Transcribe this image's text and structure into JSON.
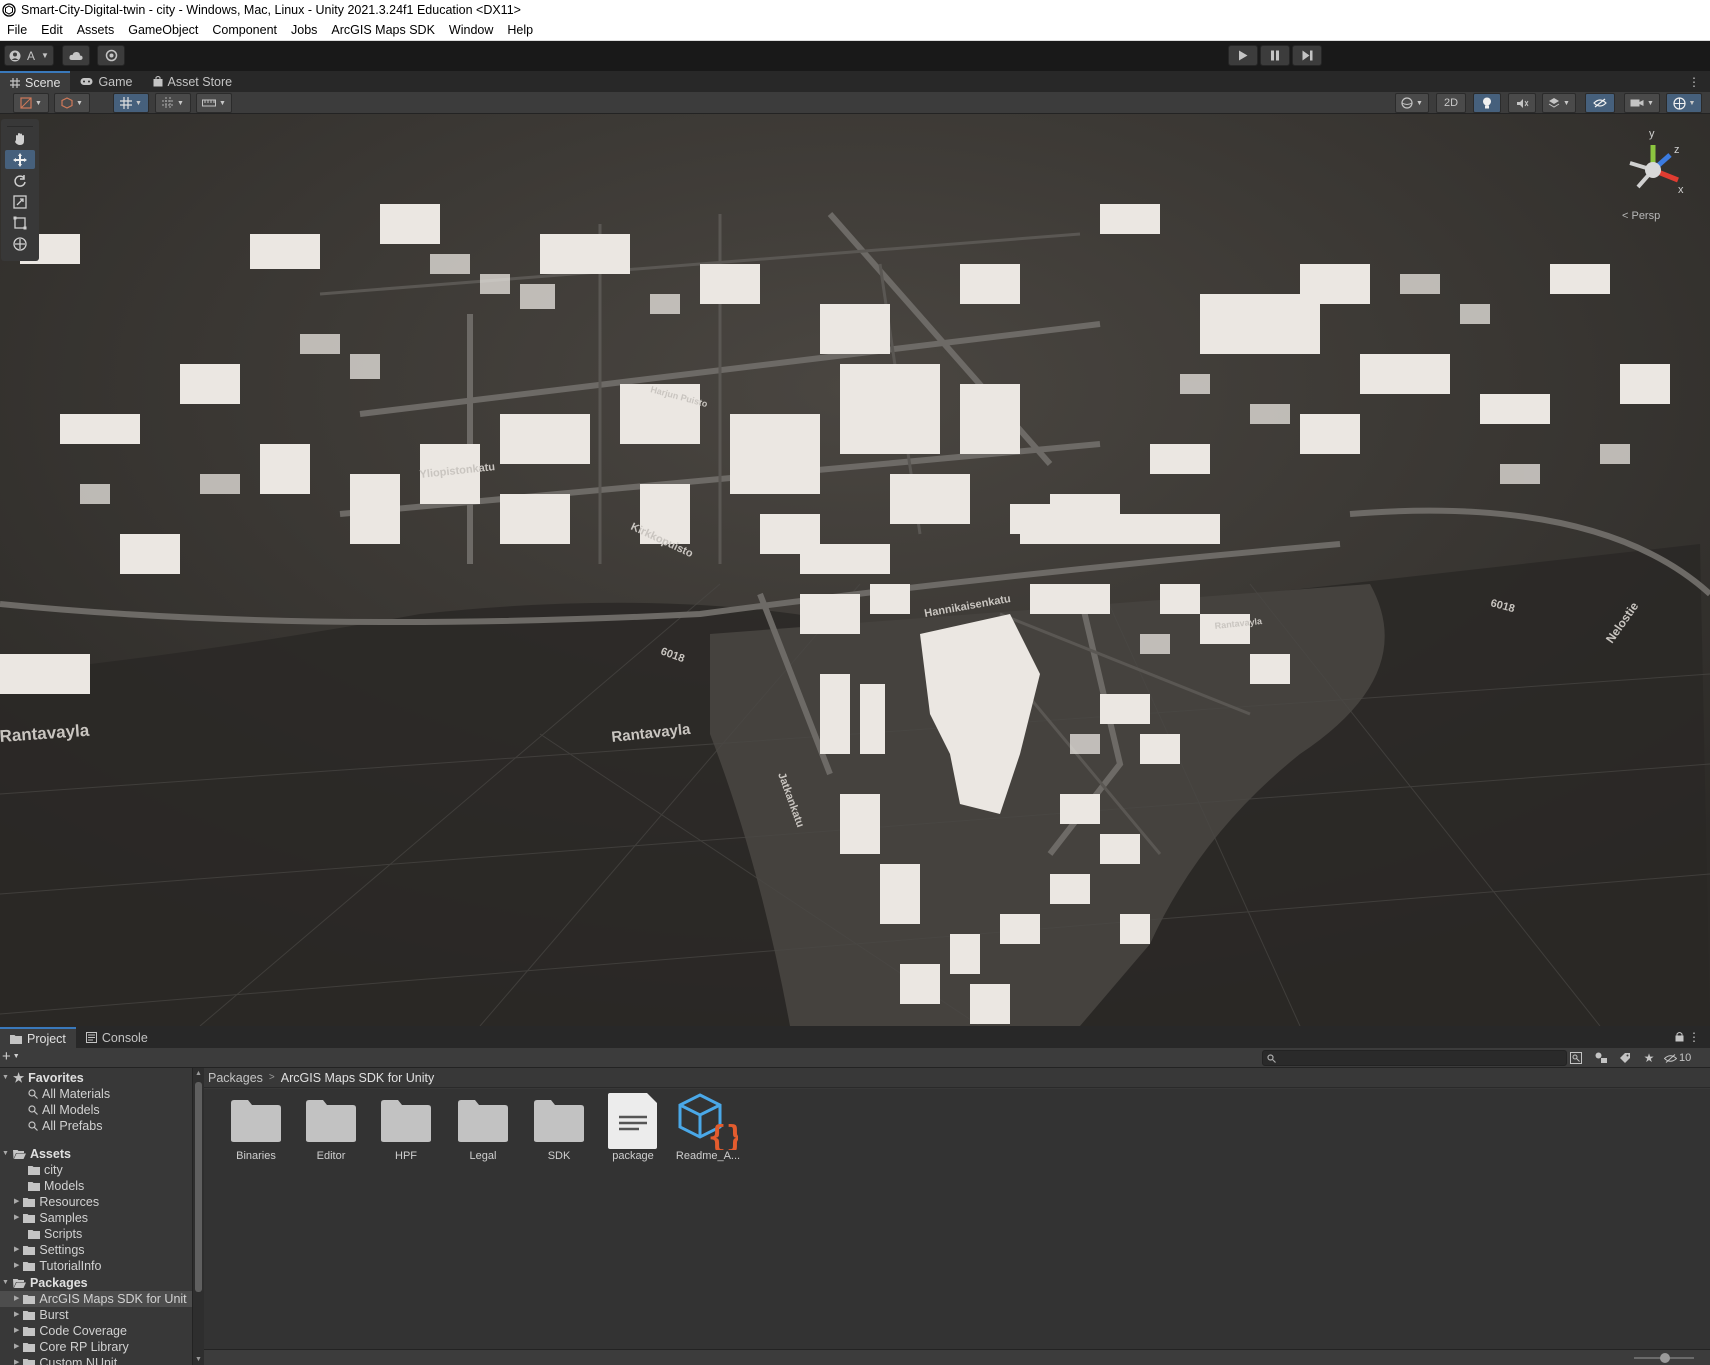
{
  "window": {
    "title": "Smart-City-Digital-twin - city - Windows, Mac, Linux - Unity 2021.3.24f1 Education <DX11>"
  },
  "menu": [
    "File",
    "Edit",
    "Assets",
    "GameObject",
    "Component",
    "Jobs",
    "ArcGIS Maps SDK",
    "Window",
    "Help"
  ],
  "toolbar": {
    "account_label": "A"
  },
  "editor_tabs": [
    "Scene",
    "Game",
    "Asset Store"
  ],
  "scene_toolbar": {
    "mode_2d_label": "2D"
  },
  "scene": {
    "projection_label": "< Persp",
    "gizmo_axes": {
      "y": "y",
      "z": "z",
      "x": "x"
    },
    "map_labels": [
      "Rantavayla",
      "Rantavayla",
      "Yliopistonkatu",
      "Kirkkopuisto",
      "Hannikaisenkatu",
      "6018",
      "6018",
      "Nelostie",
      "Jatkankatu",
      "Harjun Puisto",
      "Rantavayla"
    ]
  },
  "bottom_tabs": [
    "Project",
    "Console"
  ],
  "project": {
    "hidden_count": "10",
    "breadcrumb": [
      "Packages",
      "ArcGIS Maps SDK for Unity"
    ],
    "tree": {
      "favorites_label": "Favorites",
      "favorites": [
        "All Materials",
        "All Models",
        "All Prefabs"
      ],
      "assets_label": "Assets",
      "assets": [
        "city",
        "Models",
        "Resources",
        "Samples",
        "Scripts",
        "Settings",
        "TutorialInfo"
      ],
      "packages_label": "Packages",
      "packages": [
        "ArcGIS Maps SDK for Unit",
        "Burst",
        "Code Coverage",
        "Core RP Library",
        "Custom NUnit"
      ]
    },
    "items": [
      {
        "label": "Binaries",
        "icon": "folder-icon"
      },
      {
        "label": "Editor",
        "icon": "folder-icon"
      },
      {
        "label": "HPF",
        "icon": "folder-icon"
      },
      {
        "label": "Legal",
        "icon": "folder-icon"
      },
      {
        "label": "SDK",
        "icon": "folder-icon"
      },
      {
        "label": "package",
        "icon": "text-file-icon"
      },
      {
        "label": "Readme_A...",
        "icon": "script-package-icon"
      }
    ]
  },
  "colors": {
    "accent_blue": "#46607c",
    "tab_highlight": "#3a79bb",
    "ground": "#2f2d2a",
    "building": "#ebe7e2"
  }
}
